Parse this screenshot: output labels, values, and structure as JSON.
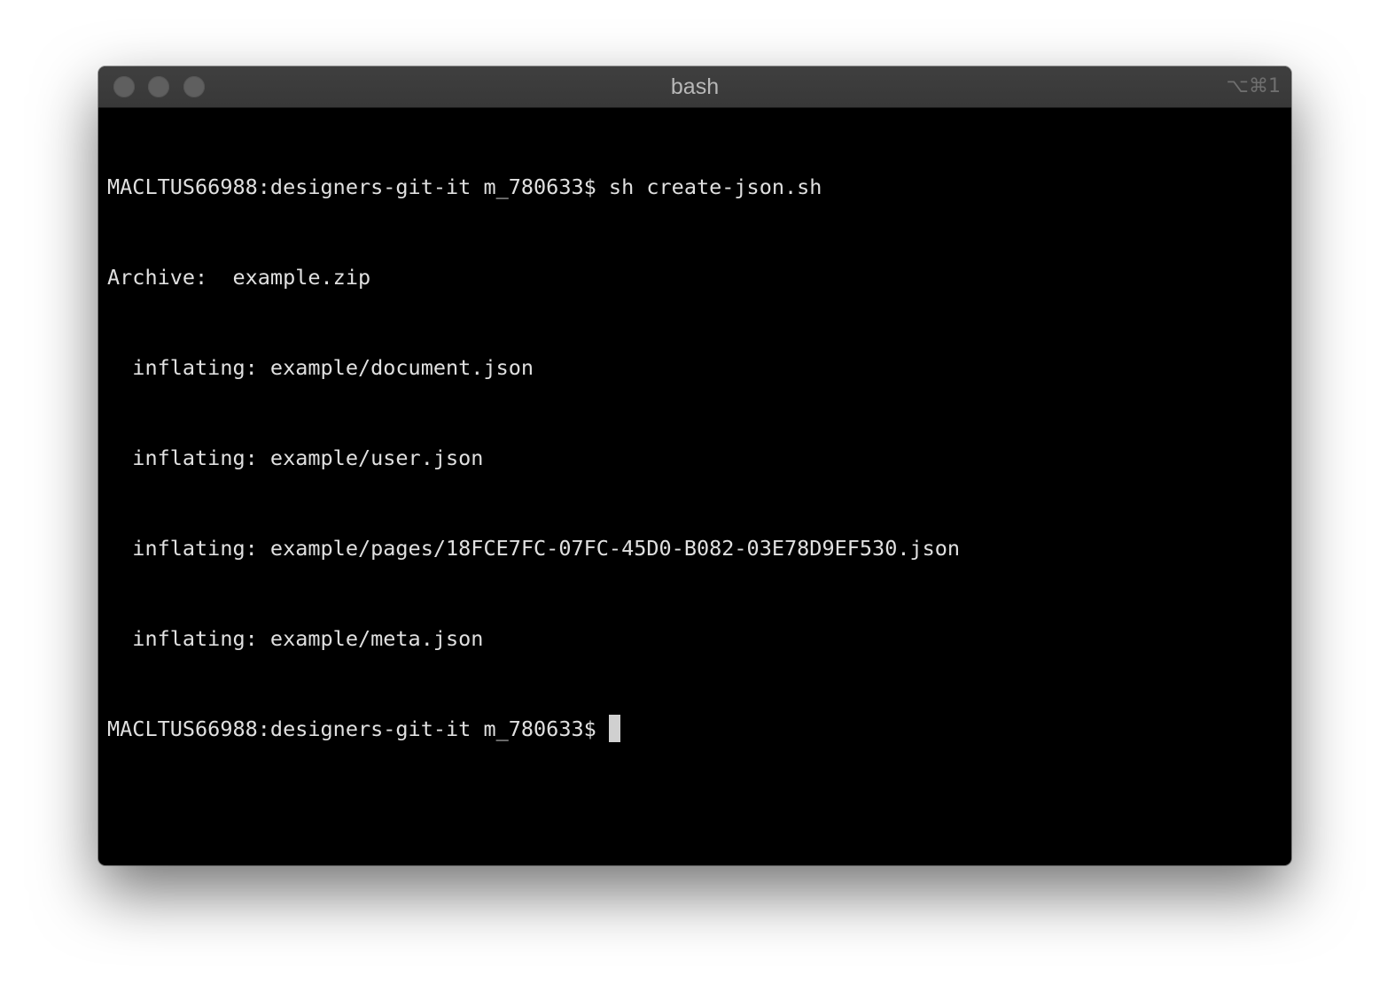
{
  "window": {
    "title": "bash",
    "shortcut": "⌥⌘1"
  },
  "terminal": {
    "lines": [
      "MACLTUS66988:designers-git-it m_780633$ sh create-json.sh",
      "Archive:  example.zip",
      "  inflating: example/document.json",
      "  inflating: example/user.json",
      "  inflating: example/pages/18FCE7FC-07FC-45D0-B082-03E78D9EF530.json",
      "  inflating: example/meta.json"
    ],
    "prompt": "MACLTUS66988:designers-git-it m_780633$ "
  }
}
